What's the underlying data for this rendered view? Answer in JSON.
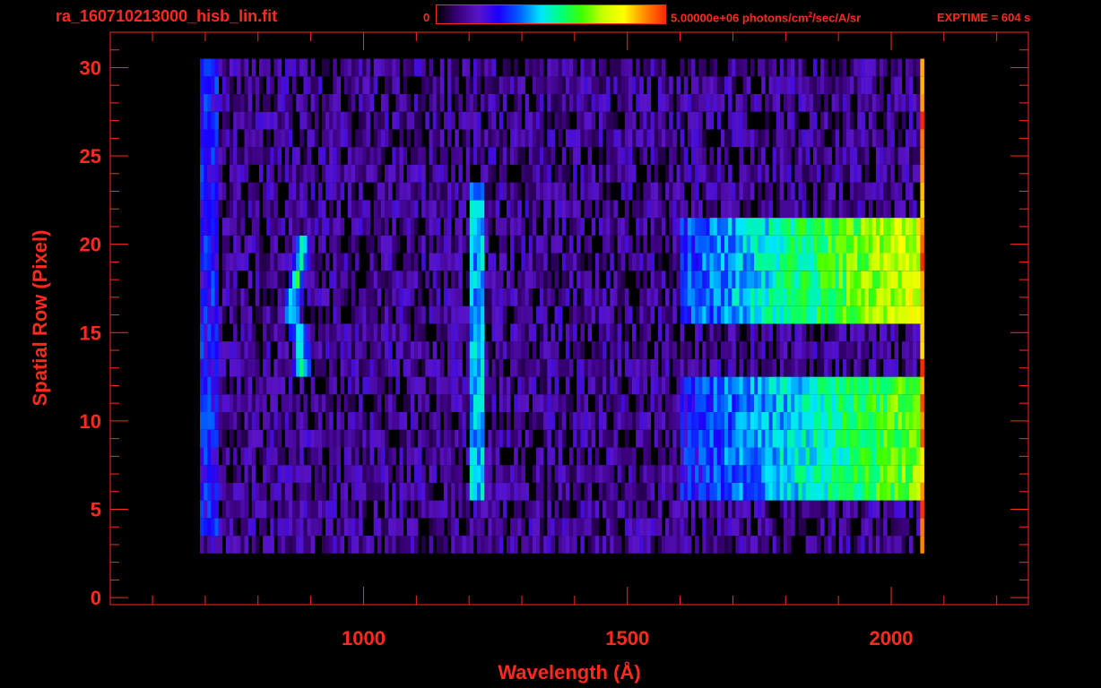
{
  "header": {
    "file_title": "ra_160710213000_hisb_lin.fit",
    "colorbar_min_label": "0",
    "colorbar_max_value": "5.00000e+06 photons/cm",
    "colorbar_max_exponent": "2",
    "colorbar_max_units": "/sec/A/sr",
    "exptime": "EXPTIME = 604 s"
  },
  "colors": {
    "axis": "#ff2a1e",
    "background": "#000000",
    "colormap": [
      "#000000",
      "#3a007a",
      "#5a14c8",
      "#1a00ff",
      "#0060ff",
      "#00e6ff",
      "#00ff78",
      "#40ff00",
      "#c8ff00",
      "#ffff00",
      "#ff8c00",
      "#ff2800"
    ]
  },
  "chart_data": {
    "type": "heatmap",
    "title": "ra_160710213000_hisb_lin.fit",
    "xlabel": "Wavelength (Å)",
    "ylabel": "Spatial Row (Pixel)",
    "xlim": [
      520,
      2260
    ],
    "ylim": [
      -0.4,
      32
    ],
    "x_ticks": [
      1000,
      1500,
      2000
    ],
    "y_ticks": [
      0,
      5,
      10,
      15,
      20,
      25,
      30
    ],
    "colorbar": {
      "min": 0,
      "max": 5000000,
      "units": "photons/cm^2/sec/A/sr"
    },
    "data_extent": {
      "x": [
        690,
        2060
      ],
      "rows": [
        3,
        30
      ]
    },
    "features": [
      {
        "x_start": 690,
        "x_end": 720,
        "rows": [
          4,
          30
        ],
        "level": 0.28
      },
      {
        "x_center": 880,
        "rows": [
          13,
          20
        ],
        "level": 0.55
      },
      {
        "x_start": 1195,
        "x_end": 1225,
        "rows": [
          6,
          23
        ],
        "level": 0.42
      },
      {
        "x_start": 1600,
        "x_end": 2060,
        "rows": [
          16,
          21
        ],
        "level": 0.78
      },
      {
        "x_start": 1600,
        "x_end": 2060,
        "rows": [
          6,
          12
        ],
        "level": 0.68
      },
      {
        "x_start": 2055,
        "x_end": 2065,
        "rows": [
          0,
          30
        ],
        "level": 0.92
      }
    ]
  }
}
